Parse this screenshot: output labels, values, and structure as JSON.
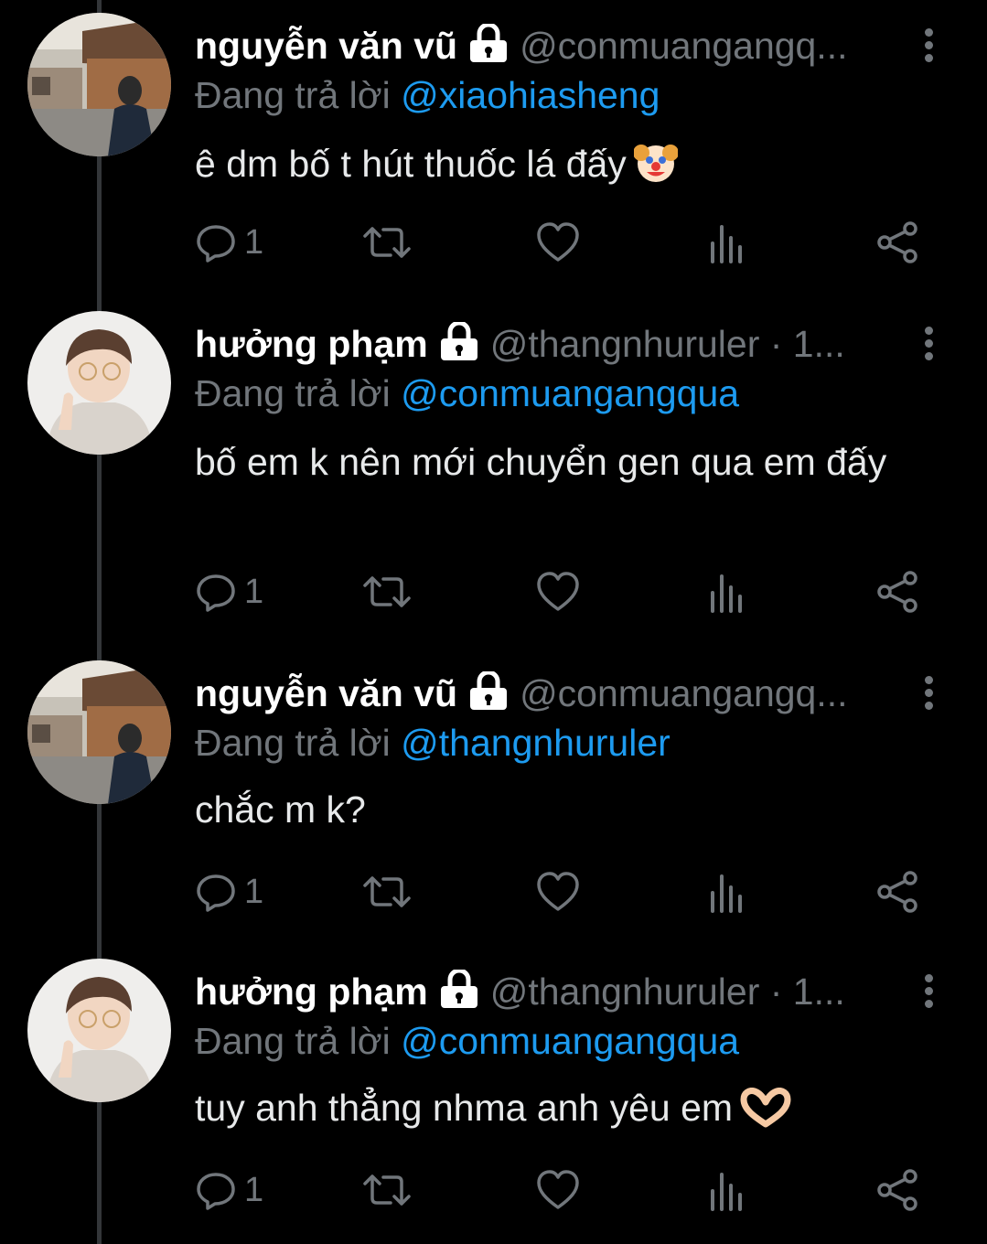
{
  "colors": {
    "background": "#000000",
    "muted": "#71767b",
    "accent": "#1d9bf0",
    "text": "#e7e9ea"
  },
  "reply_prefix": "Đang trả lời",
  "tweets": [
    {
      "name": "nguyễn văn vũ",
      "handle": "@conmuangangq...",
      "replying_to": "@xiaohiasheng",
      "text": "ê dm bố t hút thuốc lá đấy",
      "emoji": "clown-face-emoji",
      "reply_count": "1",
      "avatar": "photo-street-avatar"
    },
    {
      "name": "hưởng phạm",
      "handle": "@thangnhuruler · 1...",
      "replying_to": "@conmuangangqua",
      "text": "bố em k nên mới chuyển gen qua em đấy",
      "emoji": "",
      "reply_count": "1",
      "avatar": "photo-person-avatar"
    },
    {
      "name": "nguyễn văn vũ",
      "handle": "@conmuangangq...",
      "replying_to": "@thangnhuruler",
      "text": "chắc m k?",
      "emoji": "",
      "reply_count": "1",
      "avatar": "photo-street-avatar"
    },
    {
      "name": "hưởng phạm",
      "handle": "@thangnhuruler · 1...",
      "replying_to": "@conmuangangqua",
      "text": "tuy anh thẳng nhma anh yêu em",
      "emoji": "heart-hands-emoji",
      "reply_count": "1",
      "avatar": "photo-person-avatar"
    }
  ],
  "icons": [
    "reply-icon",
    "retweet-icon",
    "like-icon",
    "views-icon",
    "share-icon",
    "more-icon",
    "lock-icon"
  ]
}
